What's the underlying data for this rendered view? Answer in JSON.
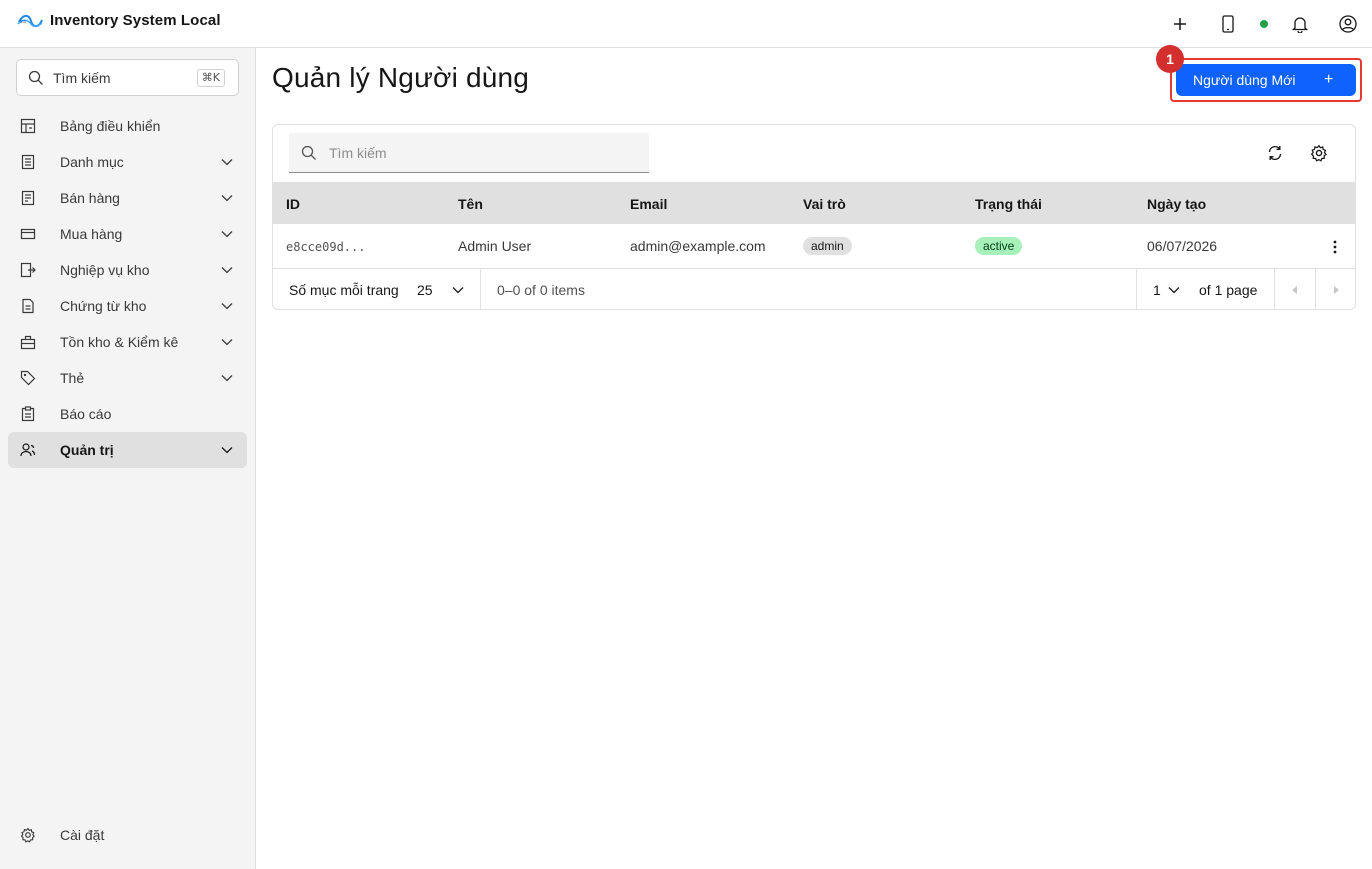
{
  "app": {
    "title": "Inventory System Local"
  },
  "header": {
    "icons": [
      "add-icon",
      "tablet-icon",
      "status-dot",
      "notification-icon",
      "user-avatar-icon"
    ],
    "status_color": "#24a148"
  },
  "sidebar": {
    "search_label": "Tìm kiếm",
    "search_shortcut": "⌘K",
    "items": [
      {
        "label": "Bảng điều khiển",
        "icon": "dashboard-icon",
        "expandable": false
      },
      {
        "label": "Danh mục",
        "icon": "catalog-icon",
        "expandable": true
      },
      {
        "label": "Bán hàng",
        "icon": "sales-icon",
        "expandable": true
      },
      {
        "label": "Mua hàng",
        "icon": "purchase-icon",
        "expandable": true
      },
      {
        "label": "Nghiệp vụ kho",
        "icon": "warehouse-ops-icon",
        "expandable": true
      },
      {
        "label": "Chứng từ kho",
        "icon": "document-icon",
        "expandable": true
      },
      {
        "label": "Tồn kho & Kiểm kê",
        "icon": "inventory-icon",
        "expandable": true
      },
      {
        "label": "Thẻ",
        "icon": "tag-icon",
        "expandable": true
      },
      {
        "label": "Báo cáo",
        "icon": "report-icon",
        "expandable": false
      },
      {
        "label": "Quản trị",
        "icon": "admin-icon",
        "expandable": true,
        "active": true
      }
    ],
    "settings_label": "Cài đặt"
  },
  "main": {
    "title": "Quản lý Người dùng",
    "new_button": "Người dùng Mới",
    "new_button_icon": "+",
    "annotation_badge": "1",
    "accent_color": "#0f62fe",
    "table": {
      "search_placeholder": "Tìm kiếm",
      "columns": [
        "ID",
        "Tên",
        "Email",
        "Vai trò",
        "Trạng thái",
        "Ngày tạo"
      ],
      "rows": [
        {
          "id": "e8cce09d...",
          "name": "Admin User",
          "email": "admin@example.com",
          "role": "admin",
          "status": "active",
          "created": "06/07/2026"
        }
      ]
    },
    "pagination": {
      "per_page_label": "Số mục mỗi trang",
      "per_page_value": "25",
      "items_text": "0–0 of 0 items",
      "page_value": "1",
      "of_pages": "of 1 page"
    }
  }
}
